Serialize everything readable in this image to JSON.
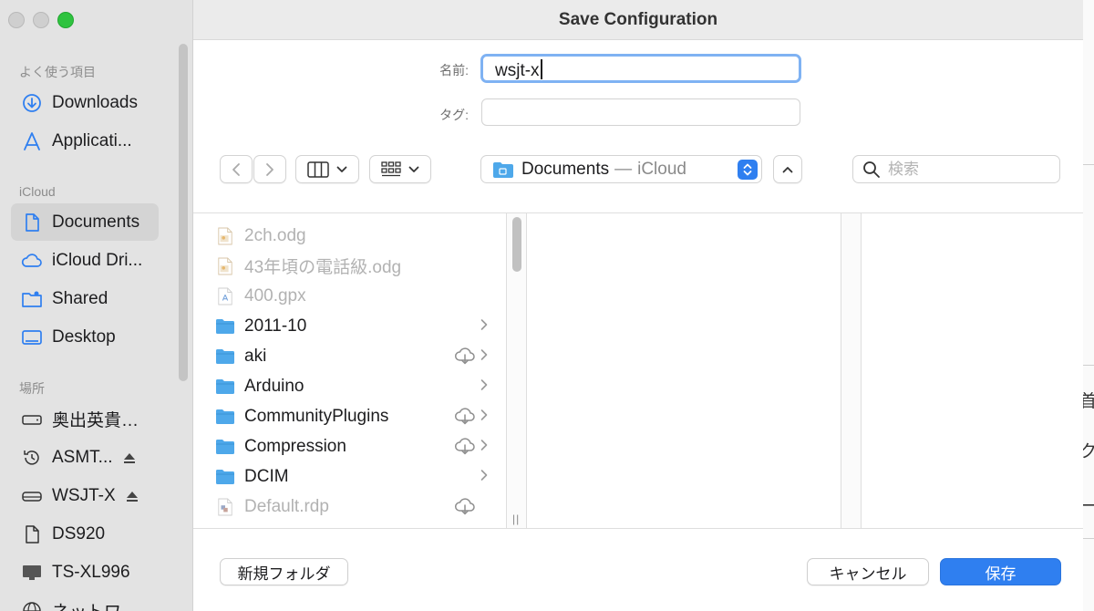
{
  "window": {
    "title": "Save Configuration"
  },
  "sidebar": {
    "favorites_header": "よく使う項目",
    "favorites": [
      {
        "label": "Downloads",
        "icon": "download-icon"
      },
      {
        "label": "Applicati...",
        "icon": "applications-icon"
      }
    ],
    "icloud_header": "iCloud",
    "icloud": [
      {
        "label": "Documents",
        "icon": "document-icon",
        "selected": true
      },
      {
        "label": "iCloud Dri...",
        "icon": "cloud-icon"
      },
      {
        "label": "Shared",
        "icon": "shared-folder-icon"
      },
      {
        "label": "Desktop",
        "icon": "desktop-icon"
      }
    ],
    "locations_header": "場所",
    "locations": [
      {
        "label": "奥出英貴…",
        "icon": "drive-icon"
      },
      {
        "label": "ASMT...",
        "icon": "time-machine-icon",
        "eject": true
      },
      {
        "label": "WSJT-X",
        "icon": "external-drive-icon",
        "eject": true
      },
      {
        "label": "DS920",
        "icon": "document-icon"
      },
      {
        "label": "TS-XL996",
        "icon": "monitor-icon"
      },
      {
        "label": "ネットワ...",
        "icon": "network-icon"
      }
    ]
  },
  "form": {
    "name_label": "名前:",
    "name_value": "wsjt-x",
    "tag_label": "タグ:",
    "tag_value": ""
  },
  "toolbar": {
    "location_name": "Documents",
    "location_separator": "—",
    "location_sub": "iCloud",
    "search_placeholder": "検索"
  },
  "files": [
    {
      "name": "2ch.odg",
      "kind": "odg",
      "dim": true,
      "cloud": false,
      "chevron": false
    },
    {
      "name": "43年頃の電話級.odg",
      "kind": "odg",
      "dim": true,
      "cloud": false,
      "chevron": false
    },
    {
      "name": "400.gpx",
      "kind": "gpx",
      "dim": true,
      "cloud": false,
      "chevron": false
    },
    {
      "name": "2011-10",
      "kind": "folder",
      "dim": false,
      "cloud": false,
      "chevron": true
    },
    {
      "name": "aki",
      "kind": "folder",
      "dim": false,
      "cloud": true,
      "chevron": true
    },
    {
      "name": "Arduino",
      "kind": "folder",
      "dim": false,
      "cloud": false,
      "chevron": true
    },
    {
      "name": "CommunityPlugins",
      "kind": "folder",
      "dim": false,
      "cloud": true,
      "chevron": true
    },
    {
      "name": "Compression",
      "kind": "folder",
      "dim": false,
      "cloud": true,
      "chevron": true
    },
    {
      "name": "DCIM",
      "kind": "folder",
      "dim": false,
      "cloud": false,
      "chevron": true
    },
    {
      "name": "Default.rdp",
      "kind": "rdp",
      "dim": true,
      "cloud": true,
      "chevron": false
    }
  ],
  "buttons": {
    "new_folder": "新規フォルダ",
    "cancel": "キャンセル",
    "save": "保存"
  },
  "background_window": {
    "glyphs": [
      "首",
      "ク",
      "ー"
    ]
  },
  "colors": {
    "accent": "#2f7ff0",
    "folder": "#4ea8ea",
    "sidebar_icon": "#2f7ff0",
    "traffic_green": "#2fc33f"
  }
}
